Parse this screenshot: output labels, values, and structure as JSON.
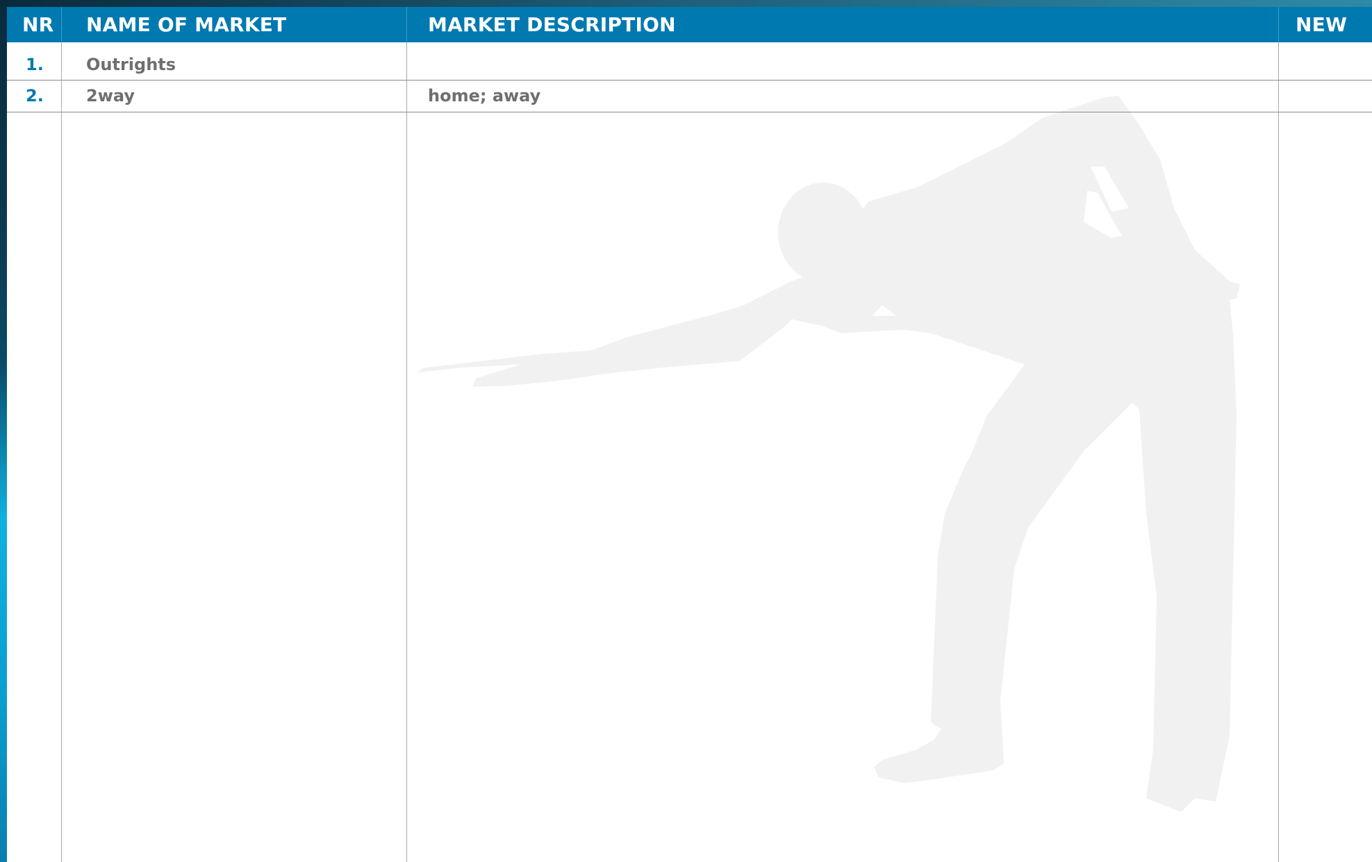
{
  "table": {
    "headers": {
      "nr": "NR",
      "name": "NAME OF MARKET",
      "description": "MARKET DESCRIPTION",
      "new": "NEW"
    },
    "rows": [
      {
        "nr": "1.",
        "name": "Outrights",
        "description": "",
        "new": ""
      },
      {
        "nr": "2.",
        "name": "2way",
        "description": "home; away",
        "new": ""
      }
    ]
  },
  "background": {
    "watermark_icon": "snooker-player-silhouette-icon"
  },
  "colors": {
    "header_bg": "#0079b0",
    "header_text": "#ffffff",
    "nr_text": "#0079b0",
    "cell_text": "#6f6f6f",
    "watermark": "#f1f1f1"
  }
}
